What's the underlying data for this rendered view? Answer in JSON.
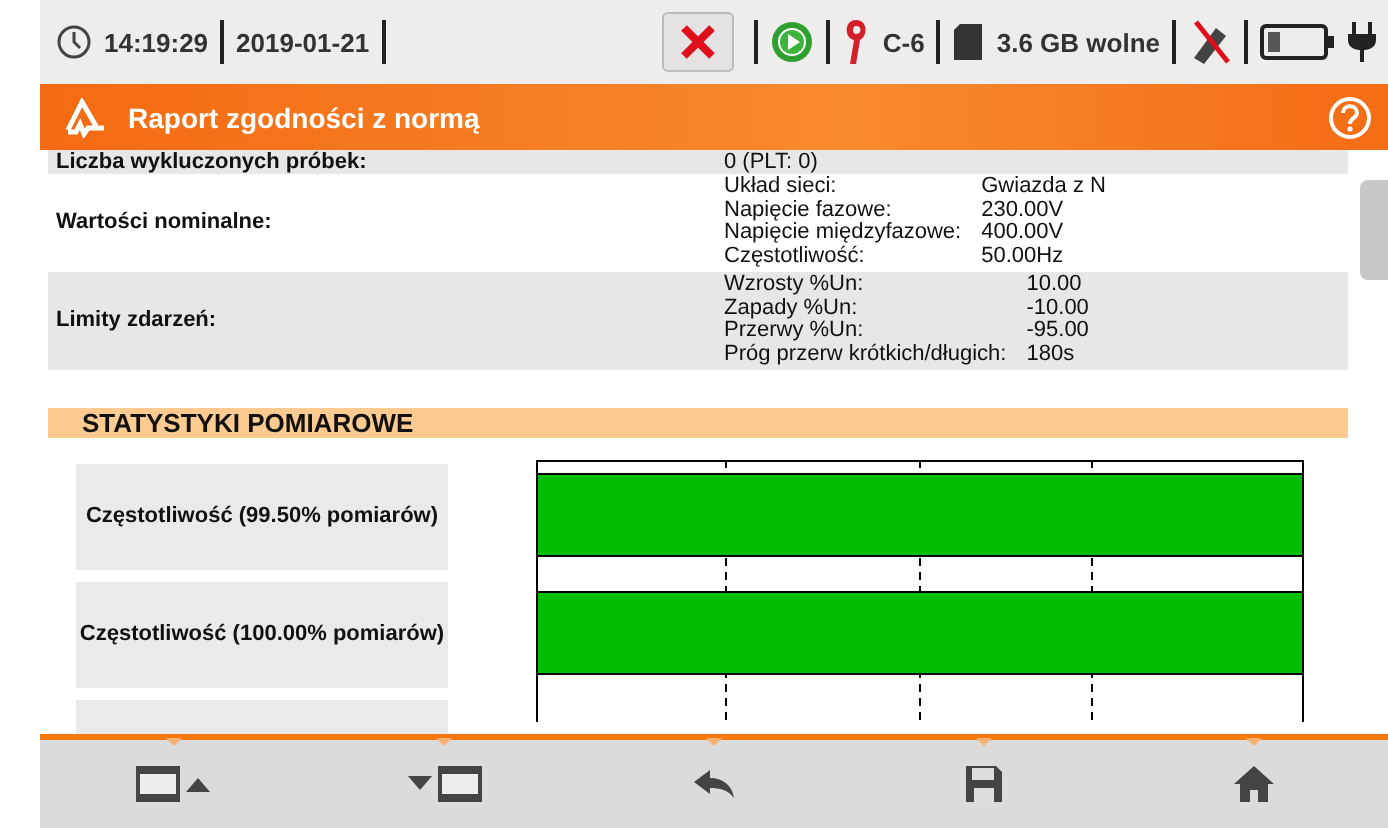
{
  "status_bar": {
    "time": "14:19:29",
    "date": "2019-01-21",
    "clamp": "C-6",
    "storage": "3.6 GB wolne"
  },
  "header": {
    "title": "Raport zgodności z normą"
  },
  "info_rows": [
    {
      "kind": "single",
      "label": "Liczba wykluczonych próbek:",
      "value": "0 (PLT: 0)"
    },
    {
      "kind": "pairs",
      "label": "Wartości nominalne:",
      "entries": [
        {
          "name": "Układ sieci:",
          "value": "Gwiazda z N"
        },
        {
          "name": "Napięcie fazowe:",
          "value": "230.00V"
        },
        {
          "name": "Napięcie międzyfazowe:",
          "value": "400.00V"
        },
        {
          "name": "Częstotliwość:",
          "value": "50.00Hz"
        }
      ]
    },
    {
      "kind": "pairs",
      "label": "Limity zdarzeń:",
      "entries": [
        {
          "name": "Wzrosty %Un:",
          "value": "10.00"
        },
        {
          "name": "Zapady %Un:",
          "value": "-10.00"
        },
        {
          "name": "Przerwy %Un:",
          "value": "-95.00"
        },
        {
          "name": "Próg przerw krótkich/długich:",
          "value": "180s"
        }
      ]
    }
  ],
  "stats": {
    "title": "STATYSTYKI POMIAROWE",
    "items": [
      {
        "kind": "bar",
        "label": "Częstotliwość (99.50% pomiarów)"
      },
      {
        "kind": "bar",
        "label": "Częstotliwość (100.00% pomiarów)"
      },
      {
        "kind": "partial"
      }
    ]
  },
  "toolbar": [
    {
      "kind": "prev"
    },
    {
      "kind": "next"
    },
    {
      "kind": "back"
    },
    {
      "kind": "save"
    },
    {
      "kind": "home"
    }
  ]
}
